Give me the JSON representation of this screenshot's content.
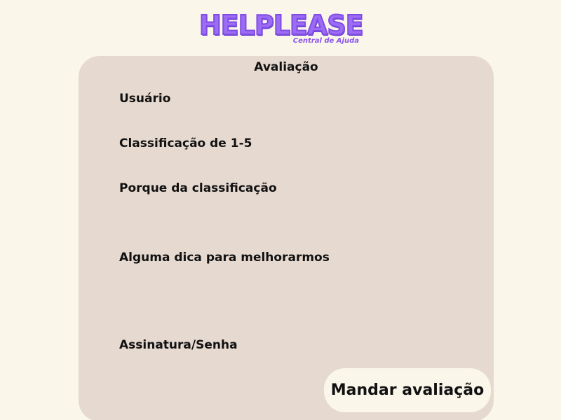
{
  "logo": {
    "title": "HELPLEASE",
    "subtitle": "Central de Ajuda",
    "color": "#9d6cf5"
  },
  "form": {
    "title": "Avaliação",
    "fields": {
      "user_label": "Usuário",
      "rating_label": "Classificação de 1-5",
      "reason_label": "Porque da classificação",
      "tip_label": "Alguma dica para melhorarmos",
      "signature_label": "Assinatura/Senha"
    },
    "submit_label": "Mandar avaliação"
  },
  "colors": {
    "background": "#faf6ea",
    "card": "#e6d9d0",
    "text": "#111111"
  }
}
